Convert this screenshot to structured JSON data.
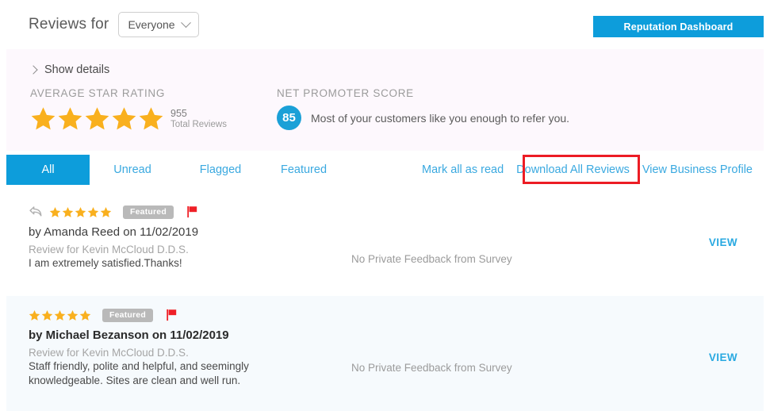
{
  "header": {
    "title": "Reviews for",
    "audience_value": "Everyone",
    "dashboard_button": "Reputation Dashboard"
  },
  "stats": {
    "show_details": "Show details",
    "rating_label": "AVERAGE STAR RATING",
    "stars_filled": 5,
    "total_reviews_count": "955",
    "total_reviews_label": "Total Reviews",
    "nps_label": "NET PROMOTER SCORE",
    "nps_score": "85",
    "nps_message": "Most of your customers like you enough to refer you."
  },
  "tabs": [
    {
      "label": "All",
      "active": true
    },
    {
      "label": "Unread",
      "active": false
    },
    {
      "label": "Flagged",
      "active": false
    },
    {
      "label": "Featured",
      "active": false
    }
  ],
  "actions": {
    "mark_all_read": "Mark all as read",
    "download_all": "Download All Reviews",
    "view_profile": "View Business Profile"
  },
  "highlight": {
    "color": "#ec1c24",
    "target": "Download All Reviews"
  },
  "reviews": [
    {
      "has_reply": true,
      "stars": 5,
      "badge": "Featured",
      "flagged": true,
      "author_line": "by Amanda Reed on 11/02/2019",
      "review_for": "Review for Kevin McCloud D.D.S.",
      "text": "I am extremely satisfied.Thanks!",
      "private_feedback": "No Private Feedback from Survey",
      "view_label": "VIEW",
      "unread": false
    },
    {
      "has_reply": false,
      "stars": 5,
      "badge": "Featured",
      "flagged": true,
      "author_line": "by Michael Bezanson on 11/02/2019",
      "review_for": "Review for Kevin McCloud D.D.S.",
      "text": "Staff friendly, polite and helpful, and seemingly knowledgeable. Sites are clean and well run.",
      "private_feedback": "No Private Feedback from Survey",
      "view_label": "VIEW",
      "unread": true
    }
  ],
  "colors": {
    "accent_blue": "#0d9ddb",
    "link_blue": "#3aa9e0",
    "star_gold": "#f9b01e",
    "flag_red": "#ef2027",
    "highlight_red": "#ec1c24",
    "panel_pink": "#fdf8fd",
    "row_unread_bg": "#f6fafd"
  }
}
